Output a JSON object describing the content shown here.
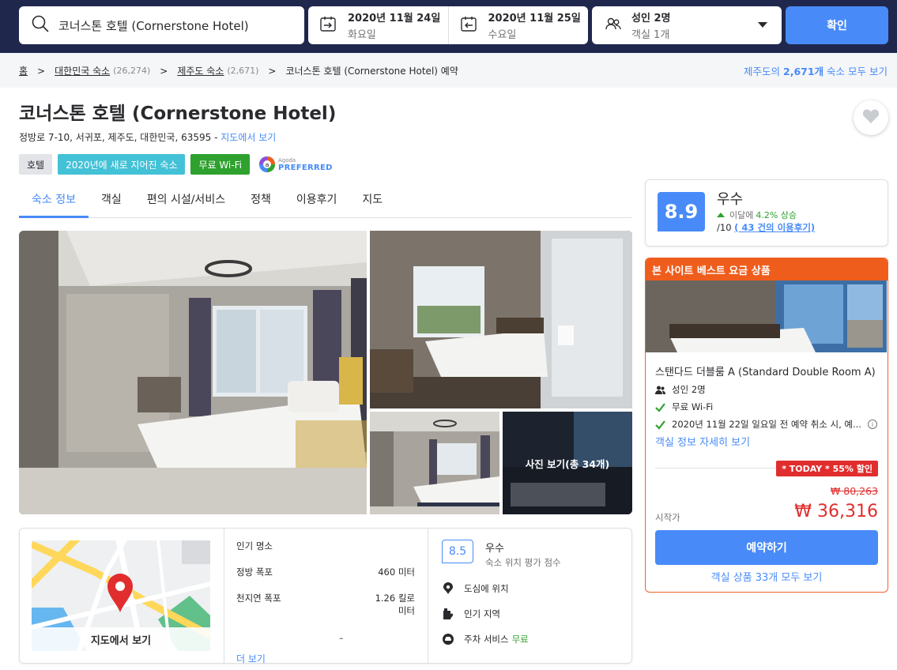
{
  "search": {
    "query": "코너스톤 호텔 (Cornerstone Hotel)",
    "checkin_date": "2020년 11월 24일",
    "checkin_day": "화요일",
    "checkout_date": "2020년 11월 25일",
    "checkout_day": "수요일",
    "guests": "성인 2명",
    "rooms": "객실 1개",
    "confirm_label": "확인"
  },
  "breadcrumb": {
    "home": "홈",
    "country": "대한민국 숙소",
    "country_count": "(26,274)",
    "region": "제주도 숙소",
    "region_count": "(2,671)",
    "current": "코너스톤 호텔 (Cornerstone Hotel) 예약",
    "right_prefix": "제주도의 ",
    "right_count": "2,671개",
    "right_suffix": " 숙소 모두 보기"
  },
  "hotel": {
    "name": "코너스톤 호텔 (Cornerstone Hotel)",
    "address": "정방로 7-10, 서귀포, 제주도, 대한민국, 63595 - ",
    "map_link": "지도에서 보기",
    "badges": [
      "호텔",
      "2020년에 새로 지어진 숙소",
      "무료 Wi-Fi"
    ],
    "agoda_small": "Agoda",
    "agoda_big": "PREFERRED"
  },
  "tabs": [
    "숙소 정보",
    "객실",
    "편의 시설/서비스",
    "정책",
    "이용후기",
    "지도"
  ],
  "photos": {
    "view_all": "사진 보기(총 34개)"
  },
  "location": {
    "map_label": "지도에서 보기",
    "poi_header": "인기 명소",
    "pois": [
      {
        "name": "정방 폭포",
        "distance": "460 미터"
      },
      {
        "name": "천지연 폭포",
        "distance": "1.26 킬로미터"
      }
    ],
    "dash": "–",
    "more": "더 보기",
    "score": "8.5",
    "score_label": "우수",
    "score_sub": "숙소 위치 평가 점수",
    "features": [
      {
        "icon": "location-pin-icon",
        "text": "도심에 위치",
        "extra": ""
      },
      {
        "icon": "popular-area-icon",
        "text": "인기 지역",
        "extra": ""
      },
      {
        "icon": "car-icon",
        "text": "주차 서비스",
        "extra": "무료"
      }
    ]
  },
  "review": {
    "score": "8.9",
    "label": "우수",
    "trend_prefix": "이달에",
    "trend_pct": "4.2% 상승",
    "out_of": "/10 ",
    "reviews_link": "( 43 건의 이용후기)"
  },
  "deal": {
    "header": "본 사이트 베스트 요금 상품",
    "room_name": "스탠다드 더블룸 A (Standard Double Room A)",
    "amenities": [
      {
        "icon": "guests-icon",
        "text": "성인 2명"
      },
      {
        "icon": "check-icon",
        "text": "무료 Wi-Fi"
      },
      {
        "icon": "check-icon",
        "text": "2020년 11월 22일 일요일 전 예약 취소 시, 예..."
      }
    ],
    "room_link": "객실 정보 자세히 보기",
    "today_badge": "* TODAY * 55% 할인",
    "old_price": "₩ 80,263",
    "start_label": "시작가",
    "new_price": "₩ 36,316",
    "book_label": "예약하기",
    "all_rooms": "객실 상품 33개 모두 보기"
  },
  "colors": {
    "navy": "#20274d",
    "primary": "#488bf8",
    "orange": "#ef5d1d",
    "red": "#e12d2d",
    "green": "#2ea12e"
  }
}
